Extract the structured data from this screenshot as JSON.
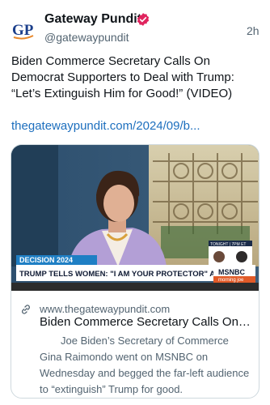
{
  "post": {
    "author": {
      "display_name": "Gateway Pundit",
      "handle": "@gatewaypundit",
      "verified": true,
      "avatar_text": "GP",
      "avatar_colors": {
        "letters": "#1b3f8b",
        "accent": "#e8882a"
      }
    },
    "timestamp": "2h",
    "text": "Biden Commerce Secretary Calls On Democrat Supporters to Deal with Trump: “Let’s Extinguish Him for Good!” (VIDEO)",
    "link_text": "thegatewaypundit.com/2024/09/b...",
    "colors": {
      "link": "#1d6fbe",
      "verified": "#e0245e",
      "secondary_text": "#536471"
    }
  },
  "card": {
    "image": {
      "banner_left": "DECISION 2024",
      "banner_headline": "TRUMP TELLS WOMEN: \"I AM YOUR PROTECTOR\" AT RALLY",
      "network": "MSNBC",
      "network_sub": "morning joe",
      "inset_text": "TONIGHT | 7PM ET"
    },
    "domain": "www.thegatewaypundit.com",
    "title": "Biden Commerce Secretary Calls On ...",
    "description": "Joe Biden’s Secretary of Commerce Gina Raimondo went on MSNBC on Wednesday and begged the far-left audience to “extinguish” Trump for good."
  }
}
